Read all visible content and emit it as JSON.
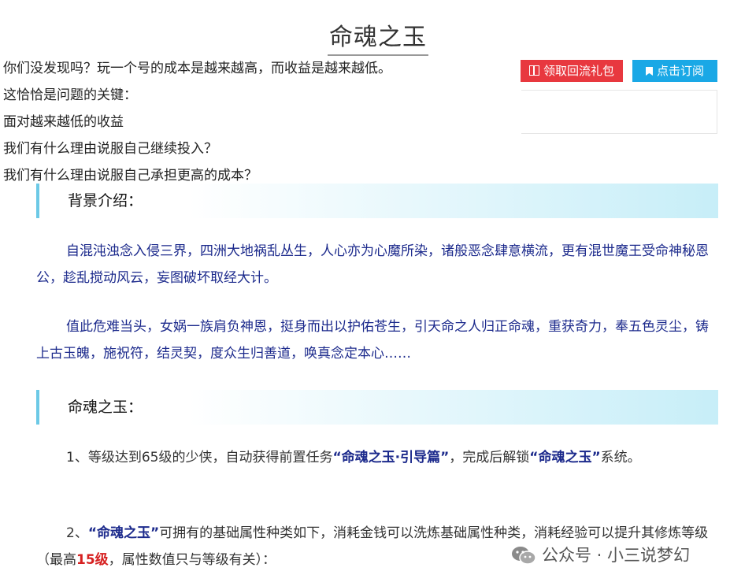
{
  "title": "命魂之玉",
  "intro": [
    "你们没发现吗？玩一个号的成本是越来越高，而收益是越来越低。",
    "这恰恰是问题的关键：",
    "面对越来越低的收益",
    "我们有什么理由说服自己继续投入？",
    "我们有什么理由说服自己承担更高的成本？"
  ],
  "buttons": {
    "gift_label": "领取回流礼包",
    "subscribe_label": "点击订阅"
  },
  "section1": {
    "heading": "背景介绍：",
    "para1": "自混沌浊念入侵三界，四洲大地祸乱丛生，人心亦为心魔所染，诸般恶念肆意横流，更有混世魔王受命神秘恩公，趁乱搅动风云，妄图破坏取经大计。",
    "para2": "值此危难当头，女娲一族肩负神恩，挺身而出以护佑苍生，引天命之人归正命魂，重获奇力，奉五色灵尘，铸上古玉魄，施祝符，结灵契，度众生归善道，唤真念定本心……"
  },
  "section2": {
    "heading": "命魂之玉：",
    "item1": {
      "prefix": "1、等级达到65级的少侠，自动获得前置任务",
      "quote1": "“命魂之玉·引导篇”",
      "middle": "，完成后解锁",
      "quote2": "“命魂之玉”",
      "suffix": "系统。"
    },
    "item2": {
      "prefix": "2、",
      "quote": "“命魂之玉”",
      "middle": "可拥有的基础属性种类如下，消耗金钱可以洗炼基础属性种类，消耗经验可以提升其修炼等级（最高",
      "highlight": "15级",
      "suffix": "，属性数值只与等级有关）："
    }
  },
  "watermark": "公众号 · 小三说梦幻",
  "colors": {
    "accent_red": "#e8383f",
    "accent_blue": "#1aa8e6",
    "text_blue": "#1c2a8c",
    "heading_bar": "#6cc9e6"
  }
}
